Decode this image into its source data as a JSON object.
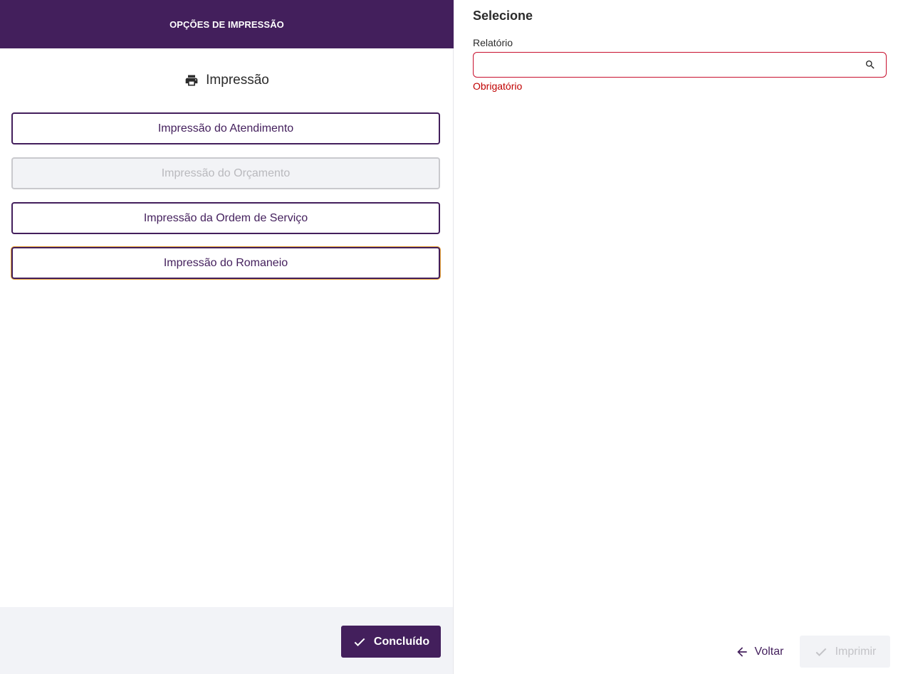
{
  "left_panel": {
    "header_title": "OPÇÕES DE IMPRESSÃO",
    "section": {
      "icon": "printer-icon",
      "label": "Impressão"
    },
    "options": [
      {
        "label": "Impressão do Atendimento",
        "enabled": true
      },
      {
        "label": "Impressão do Orçamento",
        "enabled": false
      },
      {
        "label": "Impressão da Ordem de Serviço",
        "enabled": true
      },
      {
        "label": "Impressão do Romaneio",
        "enabled": true,
        "focused": true
      }
    ],
    "footer": {
      "done_label": "Concluído",
      "done_icon": "check-icon"
    }
  },
  "right_panel": {
    "title": "Selecione",
    "report_field": {
      "label": "Relatório",
      "value": "",
      "placeholder": "",
      "error": "Obrigatório",
      "icon": "search-icon"
    },
    "actions": {
      "back_label": "Voltar",
      "back_icon": "arrow-left-icon",
      "print_label": "Imprimir",
      "print_icon": "check-icon",
      "print_enabled": false
    }
  },
  "colors": {
    "brand": "#431f5c",
    "error": "#c00000",
    "footer_bg": "#f2f3f7",
    "disabled_text": "#b9b9bd"
  }
}
